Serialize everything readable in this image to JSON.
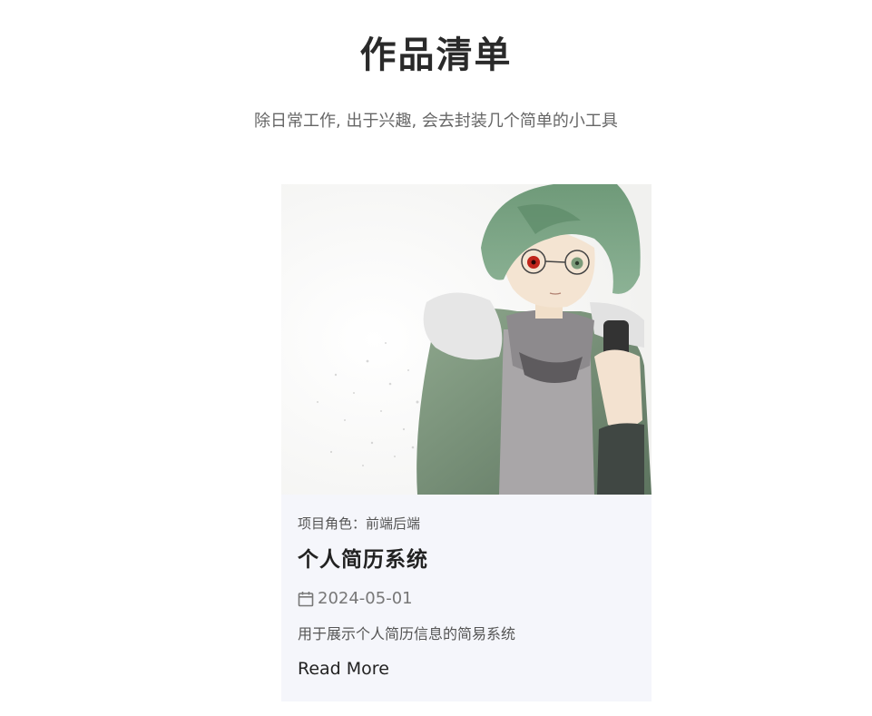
{
  "page": {
    "title": "作品清单",
    "subtitle": "除日常工作, 出于兴趣, 会去封装几个简单的小工具"
  },
  "card": {
    "image_alt": "anime-style illustration of a green-haired character with glasses holding a phone",
    "role_label": "项目角色：",
    "role_value": "前端后端",
    "title": "个人简历系统",
    "date_icon": "calendar-icon",
    "date": "2024-05-01",
    "description": "用于展示个人简历信息的简易系统",
    "read_more": "Read More"
  }
}
